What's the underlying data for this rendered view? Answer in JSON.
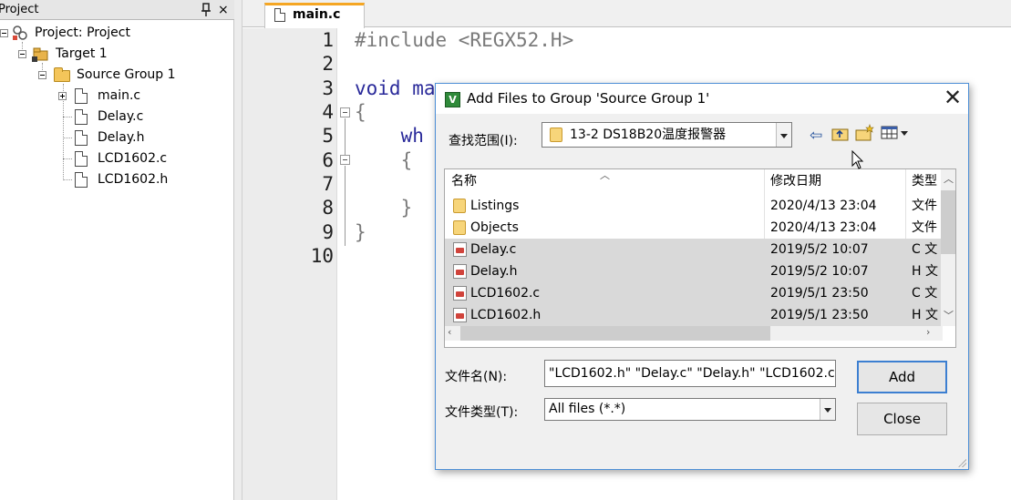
{
  "project_panel": {
    "title": "Project",
    "close_glyph": "×",
    "tree": {
      "root_label": "Project: Project",
      "target_label": "Target 1",
      "group_label": "Source Group 1",
      "files": [
        "main.c",
        "Delay.c",
        "Delay.h",
        "LCD1602.c",
        "LCD1602.h"
      ]
    }
  },
  "editor": {
    "tab_label": "main.c",
    "line_numbers": [
      "1",
      "2",
      "3",
      "4",
      "5",
      "6",
      "7",
      "8",
      "9",
      "10"
    ],
    "code_lines": [
      "#include <REGX52.H>",
      "",
      "void ma",
      "{",
      "    wh",
      "    {",
      "",
      "    }",
      "}",
      ""
    ]
  },
  "dialog": {
    "title": "Add Files to Group 'Source Group 1'",
    "close_glyph": "✕",
    "look_in_label": "查找范围(I):",
    "look_in_value": "13-2 DS18B20温度报警器",
    "columns": {
      "name": "名称",
      "date": "修改日期",
      "type": "类型"
    },
    "files": [
      {
        "name": "Listings",
        "date": "2020/4/13 23:04",
        "type": "文件",
        "kind": "folder",
        "selected": false
      },
      {
        "name": "Objects",
        "date": "2020/4/13 23:04",
        "type": "文件",
        "kind": "folder",
        "selected": false
      },
      {
        "name": "Delay.c",
        "date": "2019/5/2 10:07",
        "type": "C 文",
        "kind": "keil-file",
        "selected": true
      },
      {
        "name": "Delay.h",
        "date": "2019/5/2 10:07",
        "type": "H 文",
        "kind": "keil-file",
        "selected": true
      },
      {
        "name": "LCD1602.c",
        "date": "2019/5/1 23:50",
        "type": "C 文",
        "kind": "keil-file",
        "selected": true
      },
      {
        "name": "LCD1602.h",
        "date": "2019/5/1 23:50",
        "type": "H 文",
        "kind": "keil-file",
        "selected": true
      }
    ],
    "filename_label": "文件名(N):",
    "filename_value": "\"LCD1602.h\" \"Delay.c\" \"Delay.h\" \"LCD1602.c\"",
    "filetype_label": "文件类型(T):",
    "filetype_value": "All files (*.*)",
    "add_label": "Add",
    "close_label": "Close"
  }
}
